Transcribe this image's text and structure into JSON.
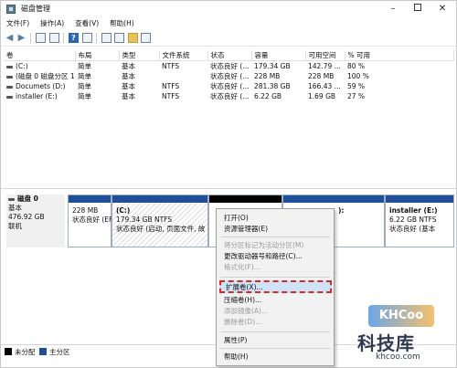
{
  "window": {
    "title": "磁盘管理"
  },
  "menubar": {
    "items": [
      "文件(F)",
      "操作(A)",
      "查看(V)",
      "帮助(H)"
    ]
  },
  "volume_table": {
    "headers": [
      "卷",
      "布局",
      "类型",
      "文件系统",
      "状态",
      "容量",
      "可用空间",
      "% 可用"
    ],
    "rows": [
      [
        "(C:)",
        "简单",
        "基本",
        "NTFS",
        "状态良好 (...",
        "179.34 GB",
        "142.79 ...",
        "80 %"
      ],
      [
        "(磁盘 0 磁盘分区 1)",
        "简单",
        "基本",
        "",
        "状态良好 (...",
        "228 MB",
        "228 MB",
        "100 %"
      ],
      [
        "Documets (D:)",
        "简单",
        "基本",
        "NTFS",
        "状态良好 (...",
        "281.38 GB",
        "166.43 ...",
        "59 %"
      ],
      [
        "installer (E:)",
        "简单",
        "基本",
        "NTFS",
        "状态良好 (...",
        "6.22 GB",
        "1.69 GB",
        "27 %"
      ]
    ]
  },
  "disk0": {
    "name": "磁盘 0",
    "type": "基本",
    "size": "476.92 GB",
    "status": "联机",
    "partitions": [
      {
        "label": "",
        "size": "228 MB",
        "status": "状态良好 (EFI"
      },
      {
        "label": "(C:)",
        "size": "179.34 GB NTFS",
        "status": "状态良好 (启动, 页面文件, 故"
      },
      {
        "label": "",
        "size": "",
        "status": ""
      },
      {
        "label": "):",
        "size": "",
        "status": ""
      },
      {
        "label": "installer (E:)",
        "size": "6.22 GB NTFS",
        "status": "状态良好 (基本"
      }
    ]
  },
  "legend": {
    "unallocated": "未分配",
    "primary": "主分区"
  },
  "context_menu": {
    "items": [
      {
        "label": "打开(O)",
        "enabled": true
      },
      {
        "label": "资源管理器(E)",
        "enabled": true
      },
      {
        "label": "将分区标记为活动分区(M)",
        "enabled": false
      },
      {
        "label": "更改驱动器号和路径(C)...",
        "enabled": true
      },
      {
        "label": "格式化(F)...",
        "enabled": false
      },
      {
        "label": "扩展卷(X)...",
        "enabled": true,
        "highlighted": true
      },
      {
        "label": "压缩卷(H)...",
        "enabled": true
      },
      {
        "label": "添加镜像(A)...",
        "enabled": false
      },
      {
        "label": "删除卷(D)...",
        "enabled": false
      },
      {
        "label": "属性(P)",
        "enabled": true
      },
      {
        "label": "帮助(H)",
        "enabled": true
      }
    ]
  },
  "watermark": {
    "badge": "KHCoo",
    "name": "科技库",
    "url": "khcoo.com"
  },
  "colors": {
    "primary_partition": "#1f4e9a",
    "unallocated": "#000000",
    "highlight": "#d62b2b"
  }
}
